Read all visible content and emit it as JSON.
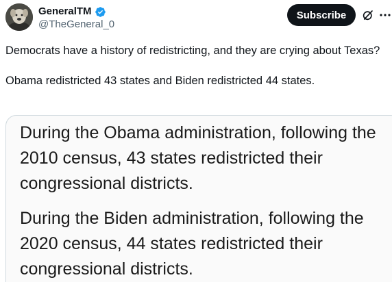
{
  "author": {
    "display_name": "GeneralTM",
    "handle": "@TheGeneral_0",
    "verified": true,
    "avatar_icon": "dog-avatar"
  },
  "actions": {
    "subscribe_label": "Subscribe",
    "grok_icon": "grok-icon",
    "more_icon": "more-icon"
  },
  "tweet": {
    "paragraphs": [
      "Democrats have a history of redistricting, and they are crying about Texas?",
      "Obama redistricted 43 states and Biden redistricted 44 states."
    ]
  },
  "media": {
    "paragraphs": [
      "During the Obama administration, following the 2010 census, 43 states redistricted their congressional districts.",
      "During the Biden administration, following the 2020 census, 44 states redistricted their congressional districts."
    ]
  },
  "colors": {
    "verified_badge": "#1d9bf0",
    "button_bg": "#0f1419",
    "secondary_text": "#536471",
    "card_border": "#cfd9de"
  }
}
